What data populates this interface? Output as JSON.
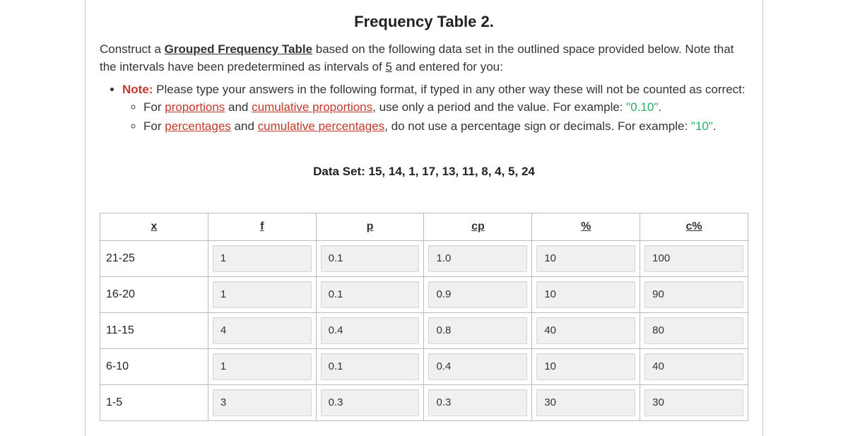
{
  "title": "Frequency Table 2.",
  "instructions": {
    "part1": "Construct a ",
    "grouped": "Grouped Frequency Table",
    "part2": " based on the following data set in the outlined space provided below. Note that the intervals have been predetermined as intervals of ",
    "five": "5",
    "part3": " and entered for you:"
  },
  "note": {
    "label": "Note:",
    "text": " Please type your answers in the following format, if typed in any other way these will not be counted as correct:"
  },
  "bullet1": {
    "a": "For ",
    "prop": "proportions",
    "b": " and ",
    "cumprop": "cumulative proportions",
    "c": ", use only a period and the value. For example: ",
    "ex": "\"0.10\"",
    "d": "."
  },
  "bullet2": {
    "a": "For ",
    "pct": "percentages",
    "b": " and ",
    "cumpct": "cumulative percentages",
    "c": ", do not use a percentage sign or decimals. For example: ",
    "ex": "\"10\"",
    "d": "."
  },
  "dataset_label": "Data Set: 15, 14, 1, 17, 13, 11, 8, 4, 5, 24",
  "headers": {
    "x": "x",
    "f": "f",
    "p": "p",
    "cp": "cp",
    "pct": "%",
    "cpct": "c%"
  },
  "rows": [
    {
      "x": "21-25",
      "f": "1",
      "p": "0.1",
      "cp": "1.0",
      "pct": "10",
      "cpct": "100"
    },
    {
      "x": "16-20",
      "f": "1",
      "p": "0.1",
      "cp": "0.9",
      "pct": "10",
      "cpct": "90"
    },
    {
      "x": "11-15",
      "f": "4",
      "p": "0.4",
      "cp": "0.8",
      "pct": "40",
      "cpct": "80"
    },
    {
      "x": "6-10",
      "f": "1",
      "p": "0.1",
      "cp": "0.4",
      "pct": "10",
      "cpct": "40"
    },
    {
      "x": "1-5",
      "f": "3",
      "p": "0.3",
      "cp": "0.3",
      "pct": "30",
      "cpct": "30"
    }
  ],
  "chart_data": {
    "type": "table",
    "title": "Grouped Frequency Table",
    "dataset": [
      15,
      14,
      1,
      17,
      13,
      11,
      8,
      4,
      5,
      24
    ],
    "interval_width": 5,
    "columns": [
      "x",
      "f",
      "p",
      "cp",
      "%",
      "c%"
    ],
    "rows": [
      {
        "interval": "21-25",
        "f": 1,
        "p": 0.1,
        "cp": 1.0,
        "pct": 10,
        "cpct": 100
      },
      {
        "interval": "16-20",
        "f": 1,
        "p": 0.1,
        "cp": 0.9,
        "pct": 10,
        "cpct": 90
      },
      {
        "interval": "11-15",
        "f": 4,
        "p": 0.4,
        "cp": 0.8,
        "pct": 40,
        "cpct": 80
      },
      {
        "interval": "6-10",
        "f": 1,
        "p": 0.1,
        "cp": 0.4,
        "pct": 10,
        "cpct": 40
      },
      {
        "interval": "1-5",
        "f": 3,
        "p": 0.3,
        "cp": 0.3,
        "pct": 30,
        "cpct": 30
      }
    ]
  }
}
